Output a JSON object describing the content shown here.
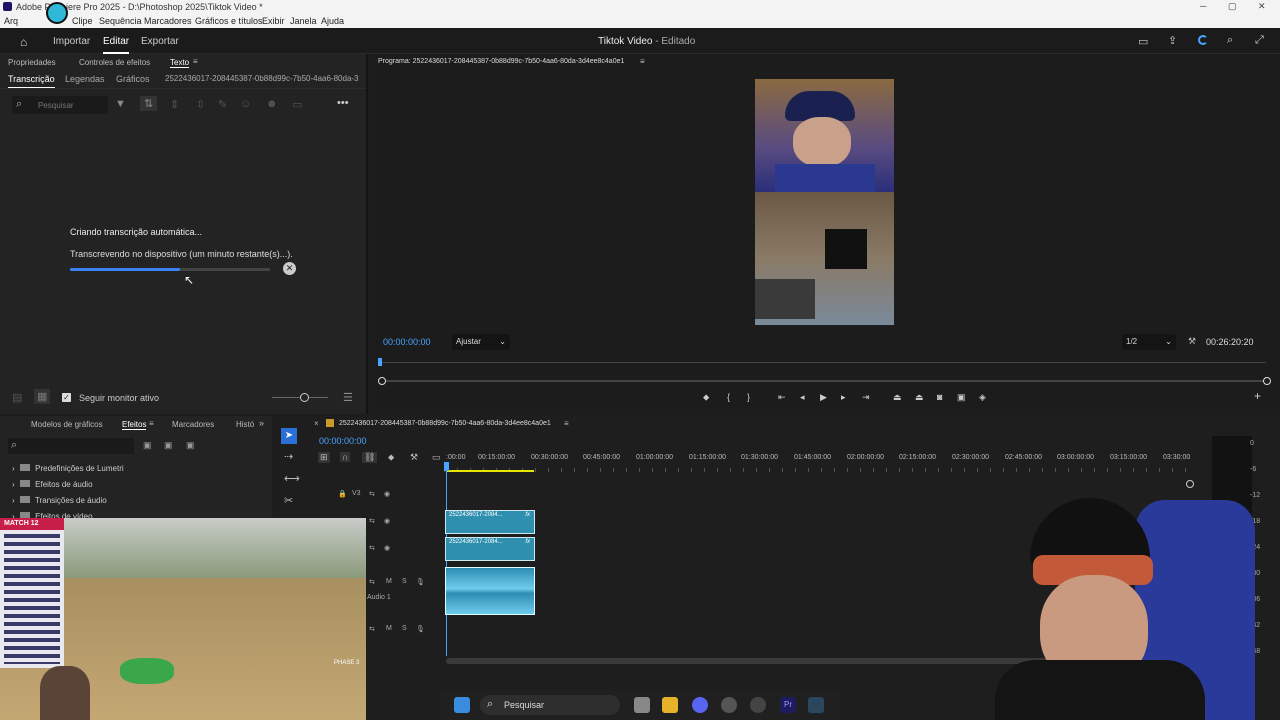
{
  "window": {
    "title": "Adobe Premiere Pro 2025 - D:\\Photoshop 2025\\Tiktok Video *"
  },
  "menu": [
    "Arq",
    "Clipe",
    "Sequência",
    "Marcadores",
    "Gráficos e títulos",
    "Exibir",
    "Janela",
    "Ajuda"
  ],
  "header": {
    "tabs": [
      "Importar",
      "Editar",
      "Exportar"
    ],
    "project_title": "Tiktok Video",
    "project_status": "- Editado"
  },
  "left_panel": {
    "panel_tabs": [
      "Propriedades",
      "Controles de efeitos",
      "Texto"
    ],
    "sub_tabs": [
      "Transcrição",
      "Legendas",
      "Gráficos"
    ],
    "sequence_name": "2522436017-208445387-0b88d99c-7b50-4aa6-80da-3",
    "search_placeholder": "Pesquisar",
    "status_title": "Criando transcrição automática...",
    "status_detail": "Transcrevendo no dispositivo (um minuto restante(s)...).",
    "progress": 0.55,
    "follow_monitor_label": "Seguir monitor ativo",
    "follow_monitor_checked": true
  },
  "program_monitor": {
    "title": "Programa: 2522436017-208445387-0b88d99c-7b50-4aa6-80da-3d4ee8c4a0e1",
    "timecode": "00:00:00:00",
    "fit_label": "Ajustar",
    "resolution_label": "1/2",
    "duration": "00:26:20:20"
  },
  "effects_panel": {
    "tabs": [
      "Modelos de gráficos",
      "Efeitos",
      "Marcadores",
      "Histó"
    ],
    "items": [
      "Predefinições de Lumetri",
      "Efeitos de áudio",
      "Transições de áudio",
      "Efeitos de vídeo"
    ]
  },
  "timeline": {
    "sequence_tab": "2522436017-208445387-0b88d99c-7b50-4aa6-80da-3d4ee8c4a0e1",
    "timecode": "00:00:00:00",
    "ruler": [
      ":00:00",
      "00:15:00:00",
      "00:30:00:00",
      "00:45:00:00",
      "01:00:00:00",
      "01:15:00:00",
      "01:30:00:00",
      "01:45:00:00",
      "02:00:00:00",
      "02:15:00:00",
      "02:30:00:00",
      "02:45:00:00",
      "03:00:00:00",
      "03:15:00:00",
      "03:30:00"
    ],
    "tracks": {
      "v3": "V3",
      "audio1": "Audio 1",
      "m": "M",
      "s": "S"
    },
    "clip_label": "2522436017-2084...",
    "fx_label": "fx",
    "meter_labels": [
      "0",
      "-6",
      "-12",
      "-18",
      "-24",
      "-30",
      "-36",
      "-42",
      "-48"
    ]
  },
  "taskbar": {
    "search_label": "Pesquisar"
  },
  "overlay": {
    "game_label": "MATCH 12",
    "phase_label": "PHASE 3"
  },
  "colors": {
    "accent_blue": "#3b82f6",
    "timecode_blue": "#4aa3ff",
    "clip": "#2f8fae"
  }
}
